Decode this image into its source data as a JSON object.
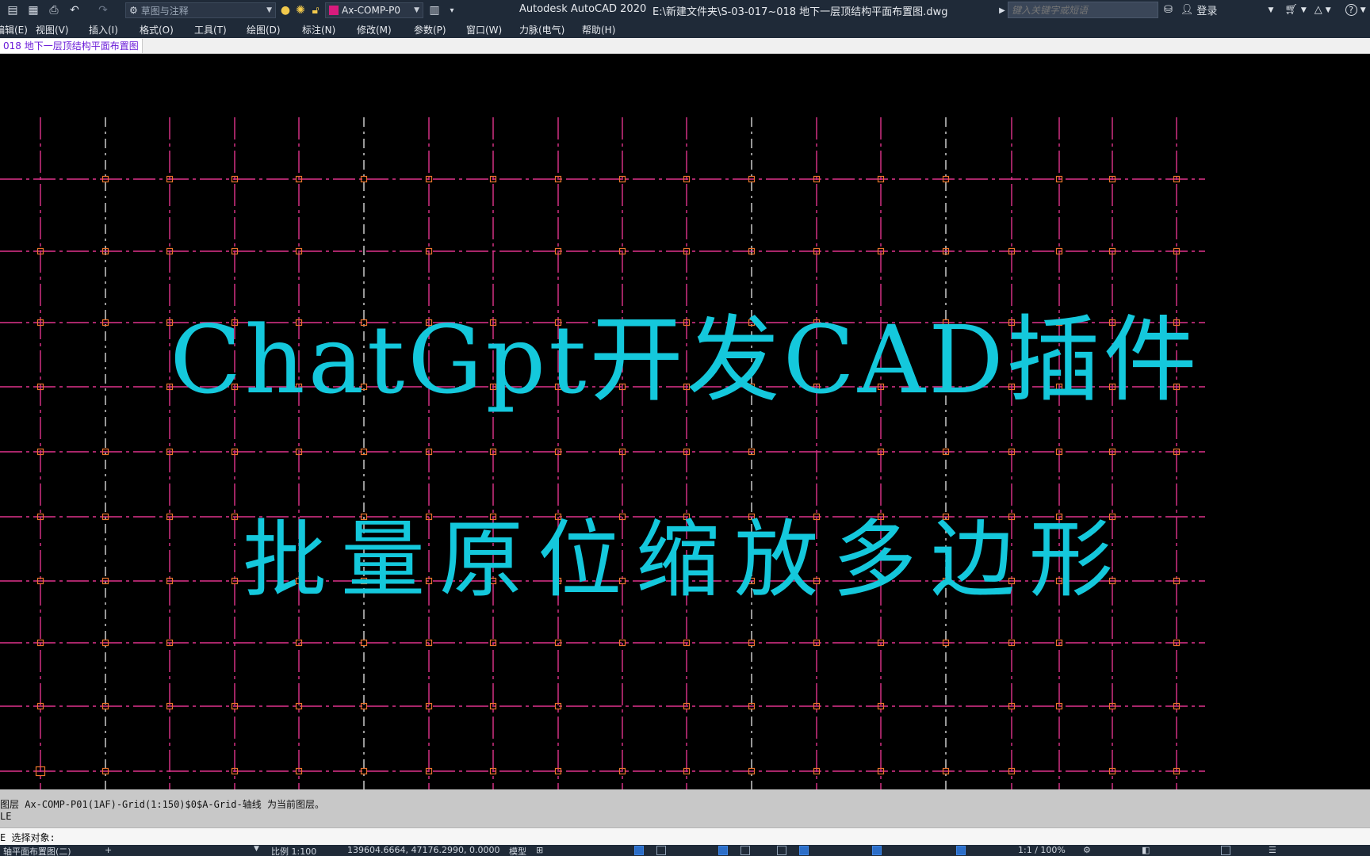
{
  "titlebar": {
    "workspace": "草图与注释",
    "layer_current": "Ax-COMP-P0",
    "app_name": "Autodesk AutoCAD 2020",
    "file_path": "E:\\新建文件夹\\S-03-017~018 地下一层顶结构平面布置图.dwg",
    "search_placeholder": "键入关键字或短语",
    "login_label": "登录"
  },
  "menubar": {
    "items": [
      "编辑(E)",
      "视图(V)",
      "插入(I)",
      "格式(O)",
      "工具(T)",
      "绘图(D)",
      "标注(N)",
      "修改(M)",
      "参数(P)",
      "窗口(W)",
      "力脉(电气)",
      "帮助(H)"
    ]
  },
  "tabs": {
    "active_label": "018 地下一层顶结构平面布置图"
  },
  "overlay": {
    "line1": "ChatGpt开发CAD插件",
    "line2": "批量原位缩放多边形"
  },
  "colors": {
    "grid_major": "#e0338c",
    "grid_minor": "#d8d8d8",
    "column_marker": "#e8742c",
    "overlay_text": "#14c8dc"
  },
  "command": {
    "history_line1": "图层 Ax-COMP-P01(1AF)-Grid(1:150)$0$A-Grid-轴线 为当前图层。",
    "history_line2": "LE",
    "prompt": "E 选择对象:"
  },
  "statusbar": {
    "layout_tab": "轴平面布置图(二)",
    "scale": "比例 1:100",
    "coordinates": "139604.6664, 47176.2990, 0.0000",
    "model_label": "模型",
    "zoom": "1:1 / 100%"
  }
}
